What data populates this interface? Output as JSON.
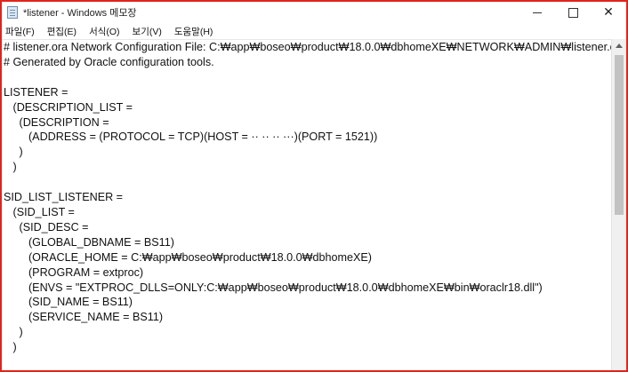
{
  "window": {
    "title": "*listener - Windows 메모장",
    "controls": {
      "close_glyph": "✕"
    }
  },
  "menu": [
    {
      "label": "파일(F)"
    },
    {
      "label": "편집(E)"
    },
    {
      "label": "서식(O)"
    },
    {
      "label": "보기(V)"
    },
    {
      "label": "도움말(H)"
    }
  ],
  "editor": {
    "lines": [
      "# listener.ora Network Configuration File: C:₩app₩boseo₩product₩18.0.0₩dbhomeXE₩NETWORK₩ADMIN₩listener.ora",
      "# Generated by Oracle configuration tools.",
      "",
      "LISTENER =",
      "   (DESCRIPTION_LIST =",
      "     (DESCRIPTION =",
      "        (ADDRESS = (PROTOCOL = TCP)(HOST = ·· ·· ·· ···)(PORT = 1521))",
      "     )",
      "   )",
      "",
      "SID_LIST_LISTENER =",
      "   (SID_LIST =",
      "     (SID_DESC =",
      "        (GLOBAL_DBNAME = BS11)",
      "        (ORACLE_HOME = C:₩app₩boseo₩product₩18.0.0₩dbhomeXE)",
      "        (PROGRAM = extproc)",
      "        (ENVS = \"EXTPROC_DLLS=ONLY:C:₩app₩boseo₩product₩18.0.0₩dbhomeXE₩bin₩oraclr18.dll\")",
      "        (SID_NAME = BS11)",
      "        (SERVICE_NAME = BS11)",
      "     )",
      "   )"
    ]
  }
}
